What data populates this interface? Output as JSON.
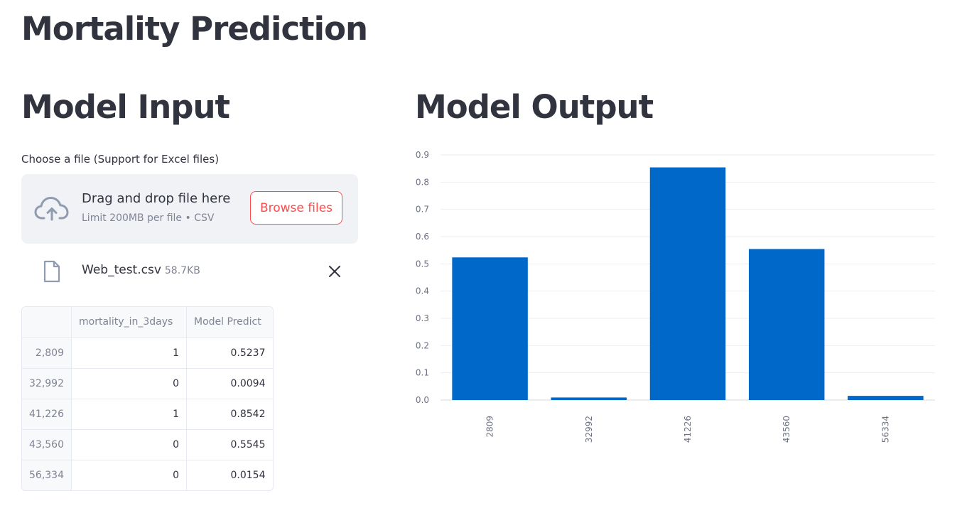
{
  "page": {
    "title": "Mortality Prediction"
  },
  "input": {
    "title": "Model Input",
    "uploader_label": "Choose a file (Support for Excel files)",
    "dropzone_text": "Drag and drop file here",
    "dropzone_limit": "Limit 200MB per file • CSV",
    "browse_label": "Browse files",
    "file_name": "Web_test.csv",
    "file_size": "58.7KB",
    "icons": {
      "upload": "cloud-upload-icon",
      "file": "file-icon",
      "remove": "close-icon"
    },
    "table": {
      "columns": [
        "",
        "mortality_in_3days",
        "Model Predict"
      ],
      "rows": [
        {
          "index": "2,809",
          "mortality": "1",
          "predict": "0.5237"
        },
        {
          "index": "32,992",
          "mortality": "0",
          "predict": "0.0094"
        },
        {
          "index": "41,226",
          "mortality": "1",
          "predict": "0.8542"
        },
        {
          "index": "43,560",
          "mortality": "0",
          "predict": "0.5545"
        },
        {
          "index": "56,334",
          "mortality": "0",
          "predict": "0.0154"
        }
      ]
    }
  },
  "output": {
    "title": "Model Output"
  },
  "chart_data": {
    "type": "bar",
    "categories": [
      "2809",
      "32992",
      "41226",
      "43560",
      "56334"
    ],
    "values": [
      0.5237,
      0.0094,
      0.8542,
      0.5545,
      0.0154
    ],
    "ylim": [
      0,
      0.9
    ],
    "yticks": [
      "0.0",
      "0.1",
      "0.2",
      "0.3",
      "0.4",
      "0.5",
      "0.6",
      "0.7",
      "0.8",
      "0.9"
    ],
    "grid": true,
    "bar_color": "#0068c9",
    "xlabel": "",
    "ylabel": ""
  },
  "theme": {
    "accent": "#ff4b4b",
    "text": "#31333f",
    "muted": "#808495",
    "dropzone_bg": "#f0f2f6"
  }
}
